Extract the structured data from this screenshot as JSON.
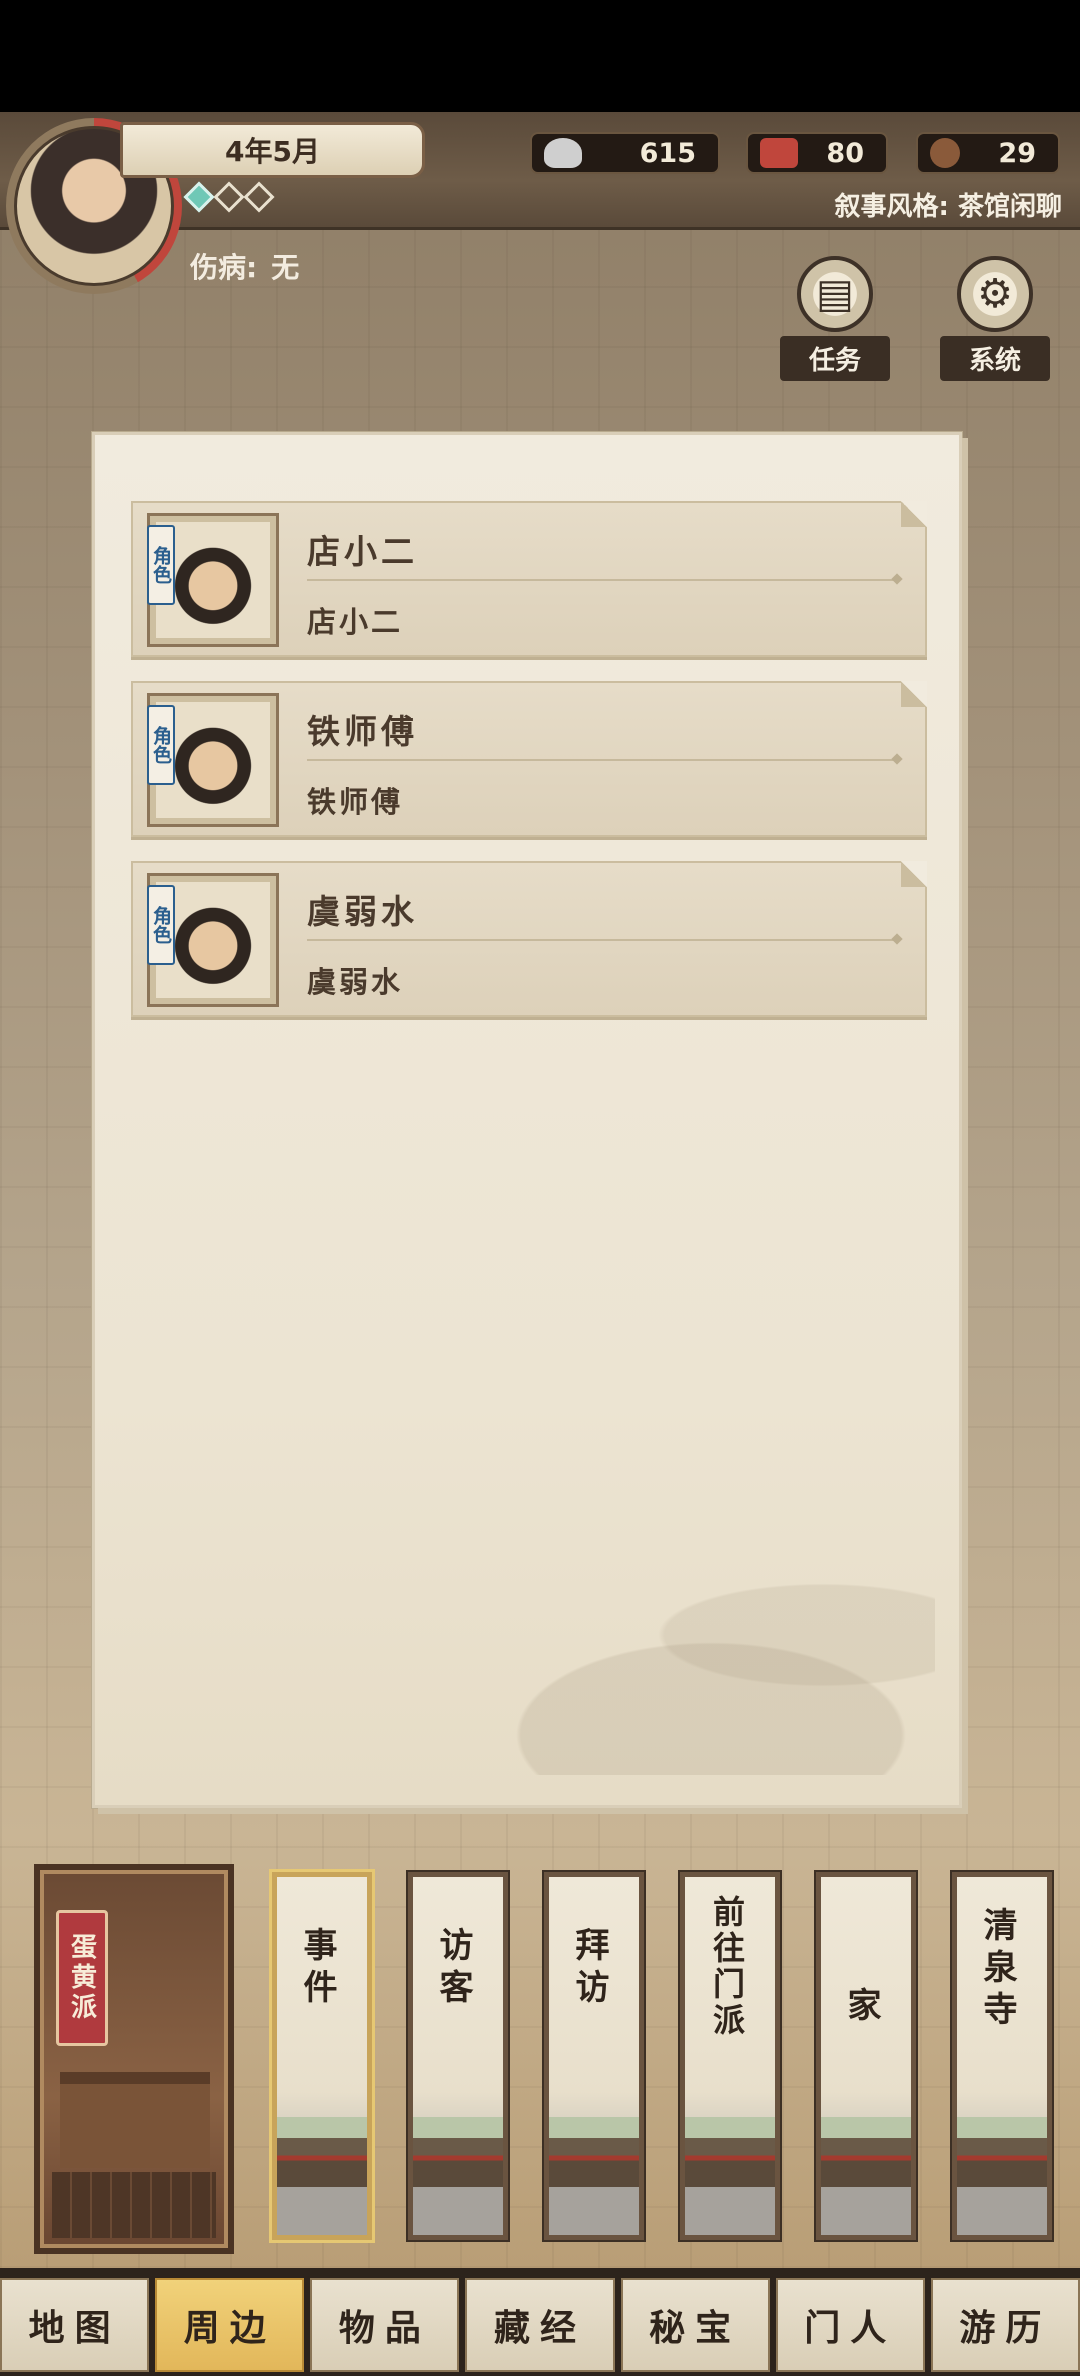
{
  "header": {
    "date": "4年5月",
    "injury_label": "伤病:",
    "injury_value": "无",
    "stars": [
      true,
      false,
      false
    ],
    "resources": [
      {
        "name": "silver-icon",
        "value": "615",
        "color": "#c9c9c9"
      },
      {
        "name": "banner-icon",
        "value": "80",
        "color": "#c0463c"
      },
      {
        "name": "badge-icon",
        "value": "29",
        "color": "#8a5a3a"
      }
    ],
    "narrative_style": "叙事风格: 茶馆闲聊"
  },
  "side_buttons": [
    {
      "label": "任务",
      "icon": "scroll-icon"
    },
    {
      "label": "系统",
      "icon": "gear-icon"
    }
  ],
  "npcs": [
    {
      "tag": "角色",
      "name": "店小二",
      "subtitle": "店小二"
    },
    {
      "tag": "角色",
      "name": "铁师傅",
      "subtitle": "铁师傅"
    },
    {
      "tag": "角色",
      "name": "虞弱水",
      "subtitle": "虞弱水"
    }
  ],
  "sect": {
    "name": "蛋黄派"
  },
  "locations": [
    {
      "label": "事件",
      "active": true
    },
    {
      "label": "访客",
      "active": false
    },
    {
      "label": "拜访",
      "active": false
    },
    {
      "label": "前往门派",
      "active": false
    },
    {
      "label": "家",
      "active": false
    },
    {
      "label": "清泉寺",
      "active": false
    }
  ],
  "tabs": [
    {
      "label": "地图",
      "active": false
    },
    {
      "label": "周边",
      "active": true
    },
    {
      "label": "物品",
      "active": false
    },
    {
      "label": "藏经",
      "active": false
    },
    {
      "label": "秘宝",
      "active": false
    },
    {
      "label": "门人",
      "active": false
    },
    {
      "label": "游历",
      "active": false
    }
  ]
}
